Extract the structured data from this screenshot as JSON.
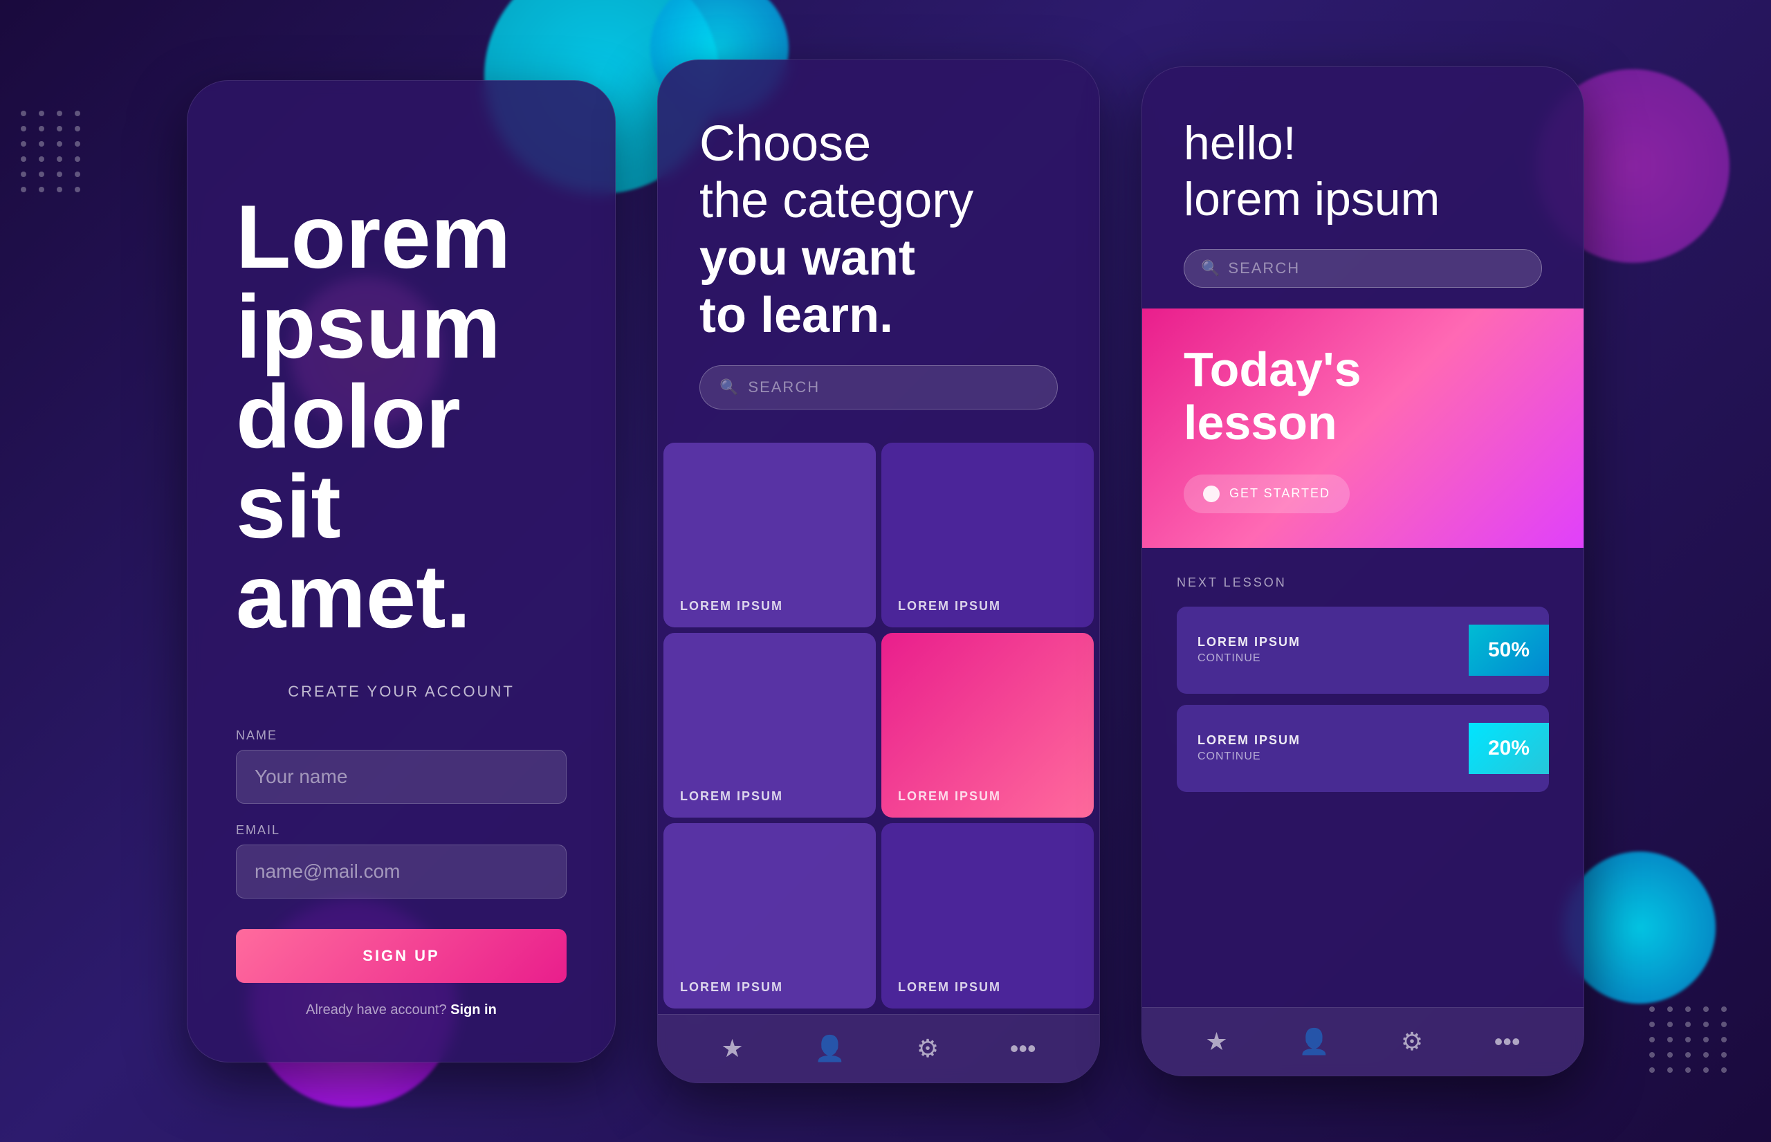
{
  "background": {
    "color": "#1a0a3d"
  },
  "screen1": {
    "headline": "Lorem ipsum dolor sit amet.",
    "create_label": "CREATE YOUR ACCOUNT",
    "name_label": "NAME",
    "name_placeholder": "Your name",
    "email_label": "EMAIL",
    "email_placeholder": "name@mail.com",
    "signup_button": "SIGN UP",
    "already_text": "Already have account?",
    "signin_link": "Sign in"
  },
  "screen2": {
    "headline_line1": "Choose",
    "headline_line2": "the category",
    "headline_bold": "you want",
    "headline_bold2": "to learn.",
    "search_placeholder": "SEARCH",
    "categories": [
      {
        "label": "LOREM IPSUM",
        "style": "purple"
      },
      {
        "label": "LOREM IPSUM",
        "style": "purple-dark"
      },
      {
        "label": "LOREM IPSUM",
        "style": "purple"
      },
      {
        "label": "LOREM IPSUM",
        "style": "pink"
      },
      {
        "label": "LOREM IPSUM",
        "style": "purple"
      },
      {
        "label": "LOREM IPSUM",
        "style": "purple"
      }
    ],
    "nav_icons": [
      "★",
      "👤",
      "⚙",
      "···"
    ]
  },
  "screen3": {
    "hello_text": "hello!\nlorem ipsum",
    "search_placeholder": "SEARCH",
    "todays_label": "TODAY'S LESSON",
    "todays_title": "Today's\nlesson",
    "get_started": "GET STARTED",
    "next_lesson_label": "NEXT LESSON",
    "lessons": [
      {
        "title": "LOREM IPSUM",
        "sub": "CONTINUE",
        "progress": "50%",
        "badge": "blue"
      },
      {
        "title": "LOREM IPSUM",
        "sub": "CONTINUE",
        "progress": "20%",
        "badge": "teal"
      }
    ],
    "nav_icons": [
      "★",
      "👤",
      "⚙",
      "···"
    ]
  }
}
